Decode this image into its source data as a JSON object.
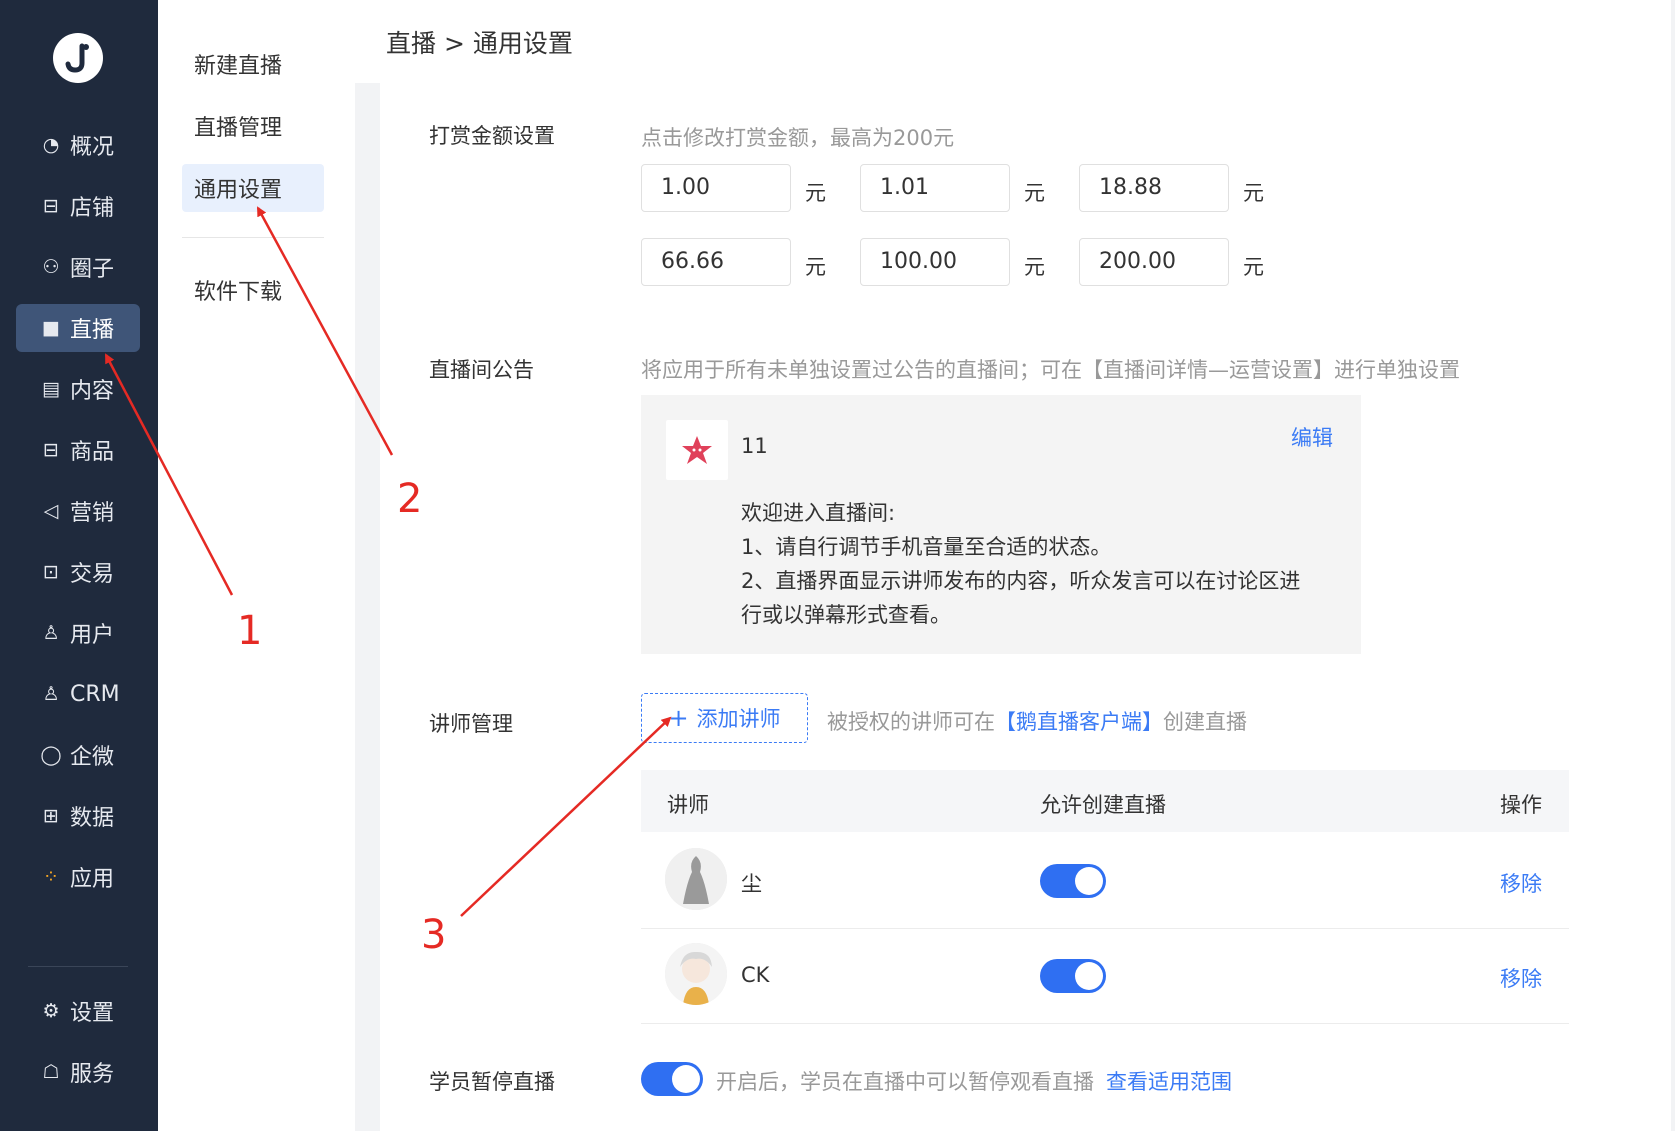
{
  "nav": {
    "items": [
      {
        "icon": "pie-chart-icon",
        "glyph": "◔",
        "label": "概况"
      },
      {
        "icon": "store-icon",
        "glyph": "⊟",
        "label": "店铺"
      },
      {
        "icon": "community-icon",
        "glyph": "⚇",
        "label": "圈子"
      },
      {
        "icon": "live-camera-icon",
        "glyph": "■",
        "label": "直播"
      },
      {
        "icon": "document-icon",
        "glyph": "▤",
        "label": "内容"
      },
      {
        "icon": "product-box-icon",
        "glyph": "⊟",
        "label": "商品"
      },
      {
        "icon": "megaphone-icon",
        "glyph": "◁",
        "label": "营销"
      },
      {
        "icon": "transaction-icon",
        "glyph": "⊡",
        "label": "交易"
      },
      {
        "icon": "user-icon",
        "glyph": "♙",
        "label": "用户"
      },
      {
        "icon": "crm-icon",
        "glyph": "♙",
        "label": "CRM"
      },
      {
        "icon": "wecom-icon",
        "glyph": "◯",
        "label": "企微"
      },
      {
        "icon": "data-chart-icon",
        "glyph": "⊞",
        "label": "数据"
      },
      {
        "icon": "apps-grid-icon",
        "glyph": "⁘",
        "label": "应用"
      },
      {
        "icon": "settings-gear-icon",
        "glyph": "⚙",
        "label": "设置"
      },
      {
        "icon": "service-icon",
        "glyph": "☖",
        "label": "服务"
      }
    ]
  },
  "subnav": {
    "items": [
      "新建直播",
      "直播管理",
      "通用设置",
      "软件下载"
    ]
  },
  "breadcrumb": "直播 > 通用设置",
  "reward": {
    "label": "打赏金额设置",
    "hint": "点击修改打赏金额，最高为200元",
    "unit": "元",
    "amounts": [
      "1.00",
      "1.01",
      "18.88",
      "66.66",
      "100.00",
      "200.00"
    ]
  },
  "announcement": {
    "label": "直播间公告",
    "hint": "将应用于所有未单独设置过公告的直播间；可在【直播间详情—运营设置】进行单独设置",
    "title": "11",
    "edit": "编辑",
    "lines": [
      "欢迎进入直播间:",
      "1、请自行调节手机音量至合适的状态。",
      "2、直播界面显示讲师发布的内容，听众发言可以在讨论区进",
      "行或以弹幕形式查看。"
    ]
  },
  "lecturer": {
    "label": "讲师管理",
    "add_button": "添加讲师",
    "hint_before": "被授权的讲师可在",
    "hint_link": "【鹅直播客户端】",
    "hint_after": "创建直播",
    "columns": [
      "讲师",
      "允许创建直播",
      "操作"
    ],
    "rows": [
      {
        "name": "尘",
        "allow": true,
        "action": "移除"
      },
      {
        "name": "CK",
        "allow": true,
        "action": "移除"
      }
    ]
  },
  "pause": {
    "label": "学员暂停直播",
    "enabled": true,
    "hint": "开启后，学员在直播中可以暂停观看直播",
    "link": "查看适用范围"
  },
  "annotations": [
    "1",
    "2",
    "3"
  ],
  "colors": {
    "nav_bg": "#1f2a3d",
    "accent": "#2f6ff2",
    "annotation": "#e52a24"
  }
}
